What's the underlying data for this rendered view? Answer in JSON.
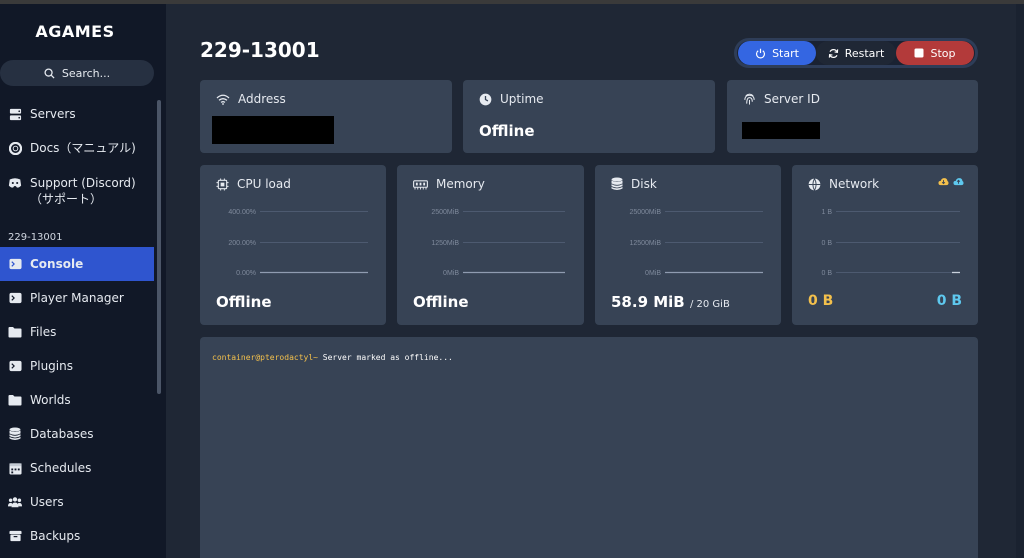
{
  "app": {
    "brand": "AGAMES"
  },
  "search": {
    "label": "Search..."
  },
  "sidebar": {
    "items": [
      {
        "label": "Servers",
        "icon": "servers-icon"
      },
      {
        "label": "Docs（マニュアル)",
        "icon": "lifebuoy-icon"
      },
      {
        "label": "Support (Discord)（サポート）",
        "icon": "discord-icon"
      }
    ],
    "section_label": "229-13001",
    "server_items": [
      {
        "label": "Console",
        "icon": "terminal-icon",
        "active": true
      },
      {
        "label": "Player Manager",
        "icon": "terminal-icon"
      },
      {
        "label": "Files",
        "icon": "folder-icon"
      },
      {
        "label": "Plugins",
        "icon": "terminal-icon"
      },
      {
        "label": "Worlds",
        "icon": "folder-icon"
      },
      {
        "label": "Databases",
        "icon": "database-icon"
      },
      {
        "label": "Schedules",
        "icon": "calendar-icon"
      },
      {
        "label": "Users",
        "icon": "users-icon"
      },
      {
        "label": "Backups",
        "icon": "archive-icon"
      }
    ]
  },
  "header": {
    "title": "229-13001"
  },
  "power": {
    "start": "Start",
    "restart": "Restart",
    "stop": "Stop"
  },
  "info": {
    "address_label": "Address",
    "uptime_label": "Uptime",
    "uptime_value": "Offline",
    "server_id_label": "Server ID"
  },
  "stats": {
    "cpu": {
      "label": "CPU load",
      "value": "Offline",
      "ticks": [
        "400.00%",
        "200.00%",
        "0.00%"
      ]
    },
    "memory": {
      "label": "Memory",
      "value": "Offline",
      "ticks": [
        "2500MiB",
        "1250MiB",
        "0MiB"
      ]
    },
    "disk": {
      "label": "Disk",
      "value": "58.9 MiB",
      "limit": "/ 20 GiB",
      "ticks": [
        "25000MiB",
        "12500MiB",
        "0MiB"
      ]
    },
    "network": {
      "label": "Network",
      "in_value": "0 B",
      "out_value": "0 B",
      "ticks": [
        "1 B",
        "0 B",
        "0 B"
      ]
    }
  },
  "console": {
    "prompt": "container@pterodactyl~",
    "message": " Server marked as offline..."
  },
  "colors": {
    "accent": "#2f55cf",
    "start": "#3466e2",
    "stop": "#b33a3a",
    "net_in": "#f3c04c",
    "net_out": "#5ec8ee"
  }
}
